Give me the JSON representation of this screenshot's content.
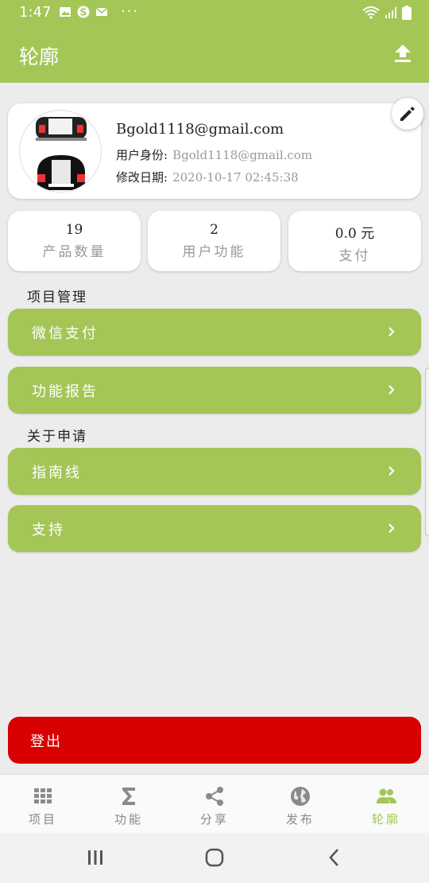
{
  "status_bar": {
    "time": "1:47",
    "dots": "···",
    "icons": [
      "gallery-icon",
      "s-app-icon",
      "mail-icon",
      "wifi-icon",
      "signal-icon",
      "battery-icon"
    ]
  },
  "app_bar": {
    "title": "轮廓",
    "action_icon": "upload-icon"
  },
  "profile": {
    "email": "Bgold1118@gmail.com",
    "identity_label": "用户身份:",
    "identity_value": "Bgold1118@gmail.com",
    "modified_label": "修改日期:",
    "modified_value": "2020-10-17 02:45:38",
    "edit_icon": "pencil-icon"
  },
  "stats": [
    {
      "value": "19",
      "label": "产品数量"
    },
    {
      "value": "2",
      "label": "用户功能"
    },
    {
      "value": "0.0 元",
      "label": "支付"
    }
  ],
  "sections": {
    "project_management": {
      "title": "项目管理",
      "items": [
        "微信支付",
        "功能报告"
      ]
    },
    "about_app": {
      "title": "关于申请",
      "items": [
        "指南线",
        "支持"
      ]
    }
  },
  "logout": {
    "label": "登出"
  },
  "bottom_nav": [
    {
      "label": "项目",
      "icon": "grid-icon"
    },
    {
      "label": "功能",
      "icon": "sigma-icon"
    },
    {
      "label": "分享",
      "icon": "share-icon"
    },
    {
      "label": "发布",
      "icon": "globe-icon"
    },
    {
      "label": "轮廓",
      "icon": "people-icon",
      "active": true
    }
  ],
  "colors": {
    "primary": "#a3c657",
    "logout": "#d80000",
    "muted_text": "#999999",
    "nav_inactive": "#8a8a8a"
  }
}
